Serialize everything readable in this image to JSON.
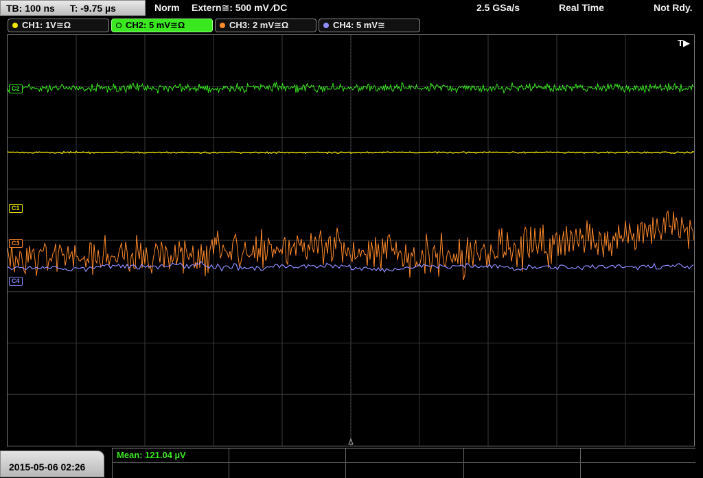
{
  "timebase": {
    "tb": "TB: 100 ns",
    "trigger_offset": "T: -9.75 µs"
  },
  "status": {
    "mode": "Norm",
    "trigger_source": "Extern≅: 500 mV ⁄DC",
    "sample_rate": "2.5 GSa/s",
    "acq_mode": "Real Time",
    "ready_state": "Not Rdy."
  },
  "channels": [
    {
      "label": "CH1: 1V≅Ω",
      "color": "#f2e600"
    },
    {
      "label": "CH2: 5 mV≅Ω",
      "color": "#39e81f"
    },
    {
      "label": "CH3: 2 mV≅Ω",
      "color": "#ff8a2a"
    },
    {
      "label": "CH4: 5 mV≅",
      "color": "#8c8cff"
    }
  ],
  "trace_labels": {
    "c2": "C2",
    "c1": "C1",
    "c3": "C3",
    "c4": "C4"
  },
  "trigger_marker": "T▶",
  "datetime": "2015-05-06 02:26",
  "measurement": {
    "mean": "Mean: 121.04 µV"
  }
}
